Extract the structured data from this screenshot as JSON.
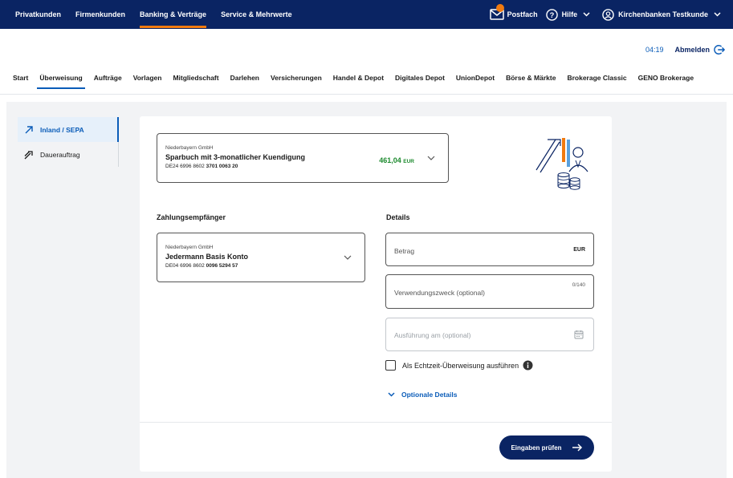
{
  "topnav": {
    "items": [
      {
        "label": "Privatkunden",
        "active": false
      },
      {
        "label": "Firmenkunden",
        "active": false
      },
      {
        "label": "Banking & Verträge",
        "active": true
      },
      {
        "label": "Service & Mehrwerte",
        "active": false
      }
    ],
    "postfach": "Postfach",
    "hilfe": "Hilfe",
    "user": "Kirchenbanken Testkunde"
  },
  "session": {
    "timer": "04:19",
    "logout": "Abmelden"
  },
  "subnav": {
    "items": [
      {
        "label": "Start",
        "active": false
      },
      {
        "label": "Überweisung",
        "active": true
      },
      {
        "label": "Aufträge",
        "active": false
      },
      {
        "label": "Vorlagen",
        "active": false
      },
      {
        "label": "Mitgliedschaft",
        "active": false
      },
      {
        "label": "Darlehen",
        "active": false
      },
      {
        "label": "Versicherungen",
        "active": false
      },
      {
        "label": "Handel & Depot",
        "active": false
      },
      {
        "label": "Digitales Depot",
        "active": false
      },
      {
        "label": "UnionDepot",
        "active": false
      },
      {
        "label": "Börse & Märkte",
        "active": false
      },
      {
        "label": "Brokerage Classic",
        "active": false
      },
      {
        "label": "GENO Brokerage",
        "active": false
      }
    ]
  },
  "sidebar": {
    "items": [
      {
        "label": "Inland / SEPA",
        "icon": "arrow-up-right-icon",
        "active": true
      },
      {
        "label": "Dauerauftrag",
        "icon": "double-arrow-up-right-icon",
        "active": false
      }
    ]
  },
  "source_account": {
    "bank": "Niederbayern GmbH",
    "name": "Sparbuch mit 3-monatlicher Kuendigung",
    "iban_prefix": "DE24 6996 8602",
    "iban_suffix": "3701 0063 20",
    "balance": "461,04",
    "currency": "EUR"
  },
  "recipient": {
    "section_title": "Zahlungsempfänger",
    "bank": "Niederbayern GmbH",
    "name": "Jedermann Basis Konto",
    "iban_prefix": "DE04 6996 8602",
    "iban_suffix": "0096 5294 57"
  },
  "details": {
    "section_title": "Details",
    "amount_placeholder": "Betrag",
    "amount_currency": "EUR",
    "purpose_placeholder": "Verwendungszweck (optional)",
    "purpose_counter": "0/140",
    "date_placeholder": "Ausführung am (optional)",
    "instant_label": "Als Echtzeit-Überweisung ausführen",
    "optional_details": "Optionale Details"
  },
  "actions": {
    "submit": "Eingaben prüfen"
  },
  "colors": {
    "navy": "#0a2463",
    "accent_orange": "#f07a10",
    "link_blue": "#0a5cb8",
    "balance_green": "#1c8a2e"
  }
}
